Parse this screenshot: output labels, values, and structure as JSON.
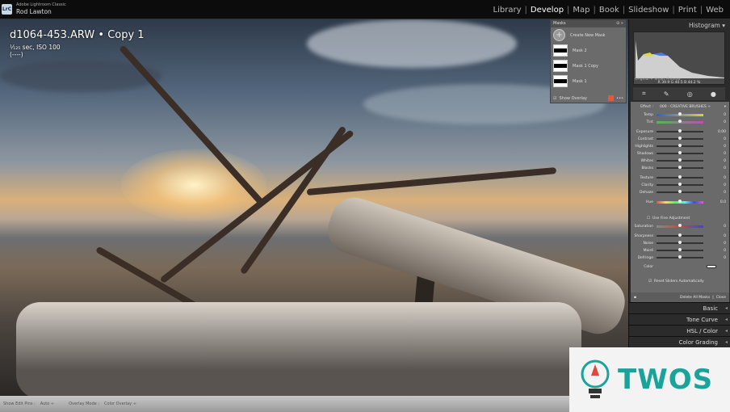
{
  "app": {
    "name": "Adobe Lightroom Classic",
    "logo": "LrC",
    "user": "Rod Lawton"
  },
  "modules": [
    "Library",
    "Develop",
    "Map",
    "Book",
    "Slideshow",
    "Print",
    "Web"
  ],
  "active_module": "Develop",
  "photo": {
    "filename": "d1064-453.ARW",
    "copy": "Copy 1",
    "separator": "•",
    "exposure": "¹⁄₁₂₅ sec, ISO 100",
    "extra": "(----)"
  },
  "masks": {
    "title": "Masks",
    "create": "Create New Mask",
    "items": [
      "Mask 2",
      "Mask 1 Copy",
      "Mask 1"
    ],
    "show_overlay": "Show Overlay",
    "overlay_color": "#e05a3c"
  },
  "histogram": {
    "title": "Histogram",
    "r_label": "R",
    "r": "39.9",
    "g_label": "G",
    "g": "40.5",
    "b_label": "B",
    "b": "44.2",
    "unit": "%",
    "preview": "Original + Smart Preview"
  },
  "effect": {
    "label": "Effect :",
    "preset": "000 - CREATIVE BRUSHES ÷"
  },
  "sliders": [
    {
      "label": "Temp",
      "value": "0",
      "pos": 0.5
    },
    {
      "label": "Tint",
      "value": "0",
      "pos": 0.5
    },
    {
      "label": "Exposure",
      "value": "0.00",
      "pos": 0.5
    },
    {
      "label": "Contrast",
      "value": "0",
      "pos": 0.5
    },
    {
      "label": "Highlights",
      "value": "0",
      "pos": 0.5
    },
    {
      "label": "Shadows",
      "value": "0",
      "pos": 0.5
    },
    {
      "label": "Whites",
      "value": "0",
      "pos": 0.5
    },
    {
      "label": "Blacks",
      "value": "0",
      "pos": 0.5
    },
    {
      "label": "Texture",
      "value": "0",
      "pos": 0.5
    },
    {
      "label": "Clarity",
      "value": "0",
      "pos": 0.5
    },
    {
      "label": "Dehaze",
      "value": "0",
      "pos": 0.5
    },
    {
      "label": "Hue",
      "value": "0.0",
      "pos": 0.5
    },
    {
      "label": "Saturation",
      "value": "0",
      "pos": 0.5
    },
    {
      "label": "Sharpness",
      "value": "0",
      "pos": 0.5
    },
    {
      "label": "Noise",
      "value": "0",
      "pos": 0.5
    },
    {
      "label": "Moiré",
      "value": "0",
      "pos": 0.5
    },
    {
      "label": "Defringe",
      "value": "0",
      "pos": 0.5
    }
  ],
  "fine_adjust": "Use Fine Adjustment",
  "color_label": "Color",
  "reset_sliders": "Reset Sliders Automatically",
  "delete_all": "Delete All Masks",
  "close": "Close",
  "sections": [
    "Basic",
    "Tone Curve",
    "HSL / Color",
    "Color Grading"
  ],
  "toolbar": {
    "show_edit_pins": "Show Edit Pins :",
    "pins_value": "Auto ÷",
    "overlay_mode": "Overlay Mode :",
    "overlay_value": "Color Overlay ÷"
  },
  "watermark": "TWOS"
}
